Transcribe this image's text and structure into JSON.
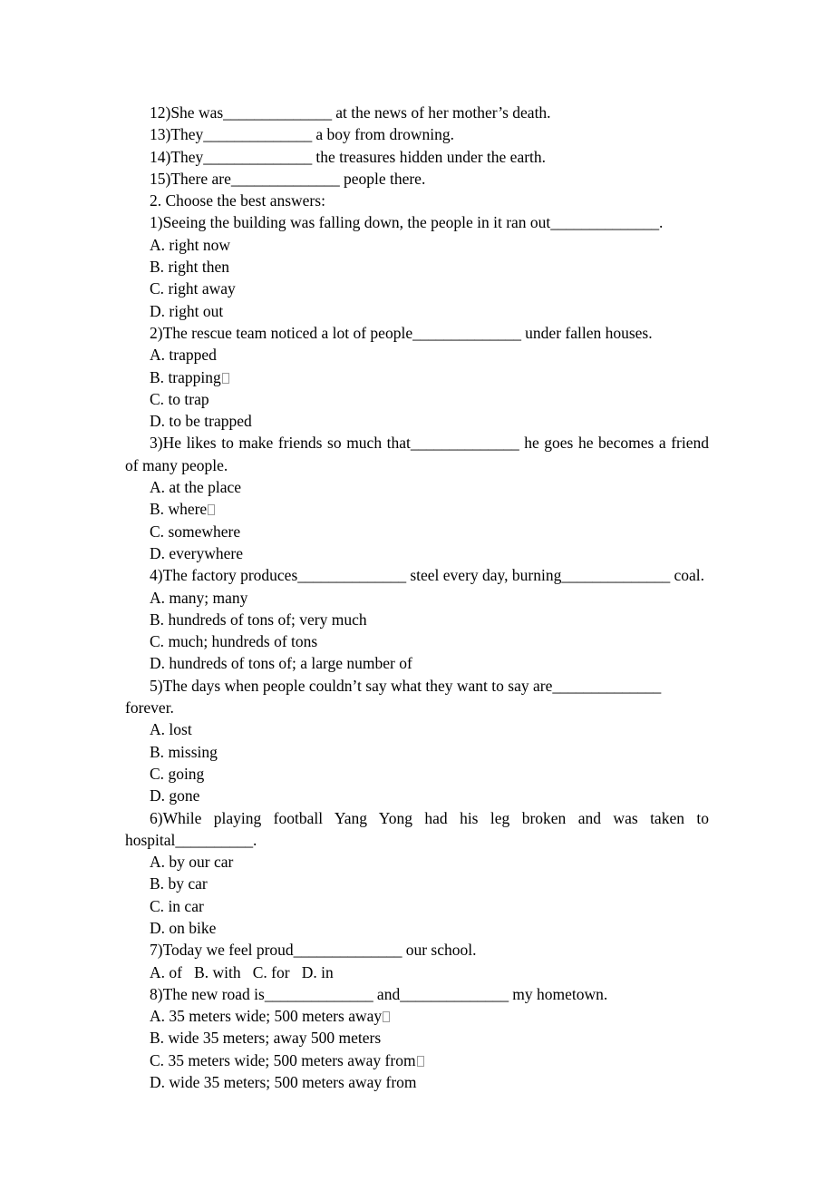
{
  "document": {
    "blank_long": "______________",
    "blank_short": "__________",
    "fill_in_items": [
      {
        "number": "12)",
        "before": "She was",
        "after": " at the news of her mother’s death."
      },
      {
        "number": "13)",
        "before": "They",
        "after": " a boy from drowning."
      },
      {
        "number": "14)",
        "before": "They",
        "after": " the treasures hidden under the earth."
      },
      {
        "number": "15)",
        "before": "There are",
        "after": " people there."
      }
    ],
    "section_heading": "2. Choose the best answers:",
    "questions": [
      {
        "number": "1)",
        "stem_before": "Seeing the building was falling down, the people in it ran out",
        "stem_after": ".",
        "justified": false,
        "options": [
          {
            "label": "A.",
            "text": "right now",
            "tofu": false
          },
          {
            "label": "B.",
            "text": "right then",
            "tofu": false
          },
          {
            "label": "C.",
            "text": "right away",
            "tofu": false
          },
          {
            "label": "D.",
            "text": "right out",
            "tofu": false
          }
        ]
      },
      {
        "number": "2)",
        "stem_before": "The rescue team noticed a lot of people",
        "stem_after": " under fallen houses.",
        "justified": false,
        "options": [
          {
            "label": "A.",
            "text": "trapped",
            "tofu": false
          },
          {
            "label": "B.",
            "text": "trapping",
            "tofu": true
          },
          {
            "label": "C.",
            "text": "to trap",
            "tofu": false
          },
          {
            "label": "D.",
            "text": "to be trapped",
            "tofu": false
          }
        ]
      },
      {
        "number": "3)",
        "stem_before": "He likes to make friends so much that",
        "stem_after": " he goes he becomes a friend of many people.",
        "justified": true,
        "options": [
          {
            "label": "A.",
            "text": "at the place",
            "tofu": false
          },
          {
            "label": "B.",
            "text": "where",
            "tofu": true
          },
          {
            "label": "C.",
            "text": "somewhere",
            "tofu": false
          },
          {
            "label": "D.",
            "text": "everywhere",
            "tofu": false
          }
        ]
      },
      {
        "number": "4)",
        "stem_before": "The factory produces",
        "stem_middle": " steel every day, burning",
        "stem_after": " coal.",
        "two_blanks": true,
        "justified": false,
        "options": [
          {
            "label": "A.",
            "text": "many; many",
            "tofu": false
          },
          {
            "label": "B.",
            "text": "hundreds of tons of; very much",
            "tofu": false
          },
          {
            "label": "C.",
            "text": "much; hundreds of tons",
            "tofu": false
          },
          {
            "label": "D.",
            "text": "hundreds of tons of; a large number of",
            "tofu": false
          }
        ]
      },
      {
        "number": "5)",
        "stem_before": "The days when people couldn’t say what they want to say are",
        "stem_after": " forever.",
        "justified": false,
        "options": [
          {
            "label": "A.",
            "text": "lost",
            "tofu": false
          },
          {
            "label": "B.",
            "text": "missing",
            "tofu": false
          },
          {
            "label": "C.",
            "text": "going",
            "tofu": false
          },
          {
            "label": "D.",
            "text": "gone",
            "tofu": false
          }
        ]
      },
      {
        "number": "6)",
        "stem_before": "While playing football Yang Yong had his leg broken and was taken to hospital",
        "stem_after": ".",
        "short_blank": true,
        "justified": true,
        "options": [
          {
            "label": "A.",
            "text": "by our car",
            "tofu": false
          },
          {
            "label": "B.",
            "text": "by car",
            "tofu": false
          },
          {
            "label": "C.",
            "text": "in car",
            "tofu": false
          },
          {
            "label": "D.",
            "text": "on bike",
            "tofu": false
          }
        ]
      },
      {
        "number": "7)",
        "stem_before": "Today we feel proud",
        "stem_after": " our school.",
        "justified": false,
        "options_inline": "A. of   B. with   C. for   D. in"
      },
      {
        "number": "8)",
        "stem_before": "The new road is",
        "stem_middle": " and",
        "stem_after": " my hometown.",
        "two_blanks": true,
        "justified": false,
        "options": [
          {
            "label": "A.",
            "text": "35 meters wide; 500 meters away",
            "tofu": true
          },
          {
            "label": "B.",
            "text": "wide 35 meters; away 500 meters",
            "tofu": false
          },
          {
            "label": "C.",
            "text": "35 meters wide; 500 meters away from",
            "tofu": true
          },
          {
            "label": "D.",
            "text": "wide 35 meters; 500 meters away from",
            "tofu": false
          }
        ]
      }
    ]
  }
}
